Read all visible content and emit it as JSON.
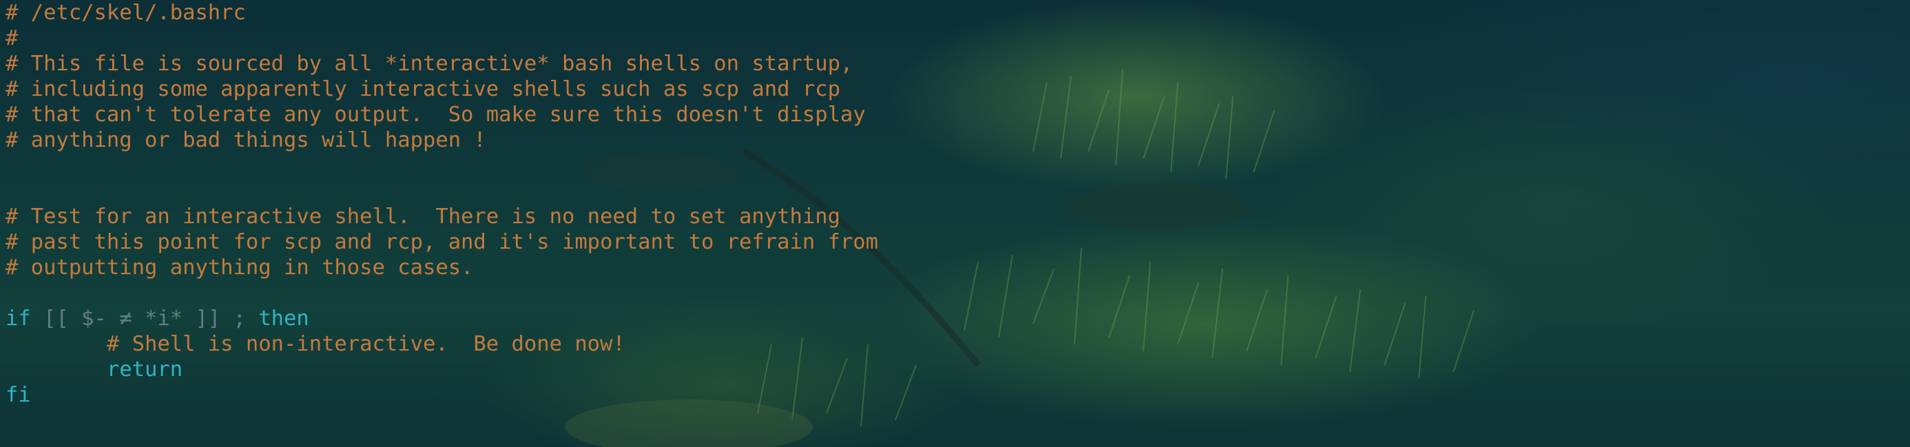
{
  "colors": {
    "comment": "#c47a3e",
    "keyword": "#2fb3c5",
    "muted": "#5f7f86",
    "background": "#0c2f38"
  },
  "editor": {
    "lines": [
      {
        "type": "comment",
        "text": "# /etc/skel/.bashrc"
      },
      {
        "type": "comment",
        "text": "#"
      },
      {
        "type": "comment",
        "text": "# This file is sourced by all *interactive* bash shells on startup,"
      },
      {
        "type": "comment",
        "text": "# including some apparently interactive shells such as scp and rcp"
      },
      {
        "type": "comment",
        "text": "# that can't tolerate any output.  So make sure this doesn't display"
      },
      {
        "type": "comment",
        "text": "# anything or bad things will happen !"
      },
      {
        "type": "blank",
        "text": ""
      },
      {
        "type": "blank",
        "text": ""
      },
      {
        "type": "comment",
        "text": "# Test for an interactive shell.  There is no need to set anything"
      },
      {
        "type": "comment",
        "text": "# past this point for scp and rcp, and it's important to refrain from"
      },
      {
        "type": "comment",
        "text": "# outputting anything in those cases."
      },
      {
        "type": "blank",
        "text": ""
      },
      {
        "type": "if-line",
        "kw_if": "if",
        "condition": " [[ $- ≠ *i* ]] ; ",
        "kw_then": "then"
      },
      {
        "type": "comment",
        "indent": "        ",
        "text": "# Shell is non-interactive.  Be done now!"
      },
      {
        "type": "keyword",
        "indent": "        ",
        "text": "return"
      },
      {
        "type": "keyword",
        "text": "fi"
      }
    ]
  }
}
